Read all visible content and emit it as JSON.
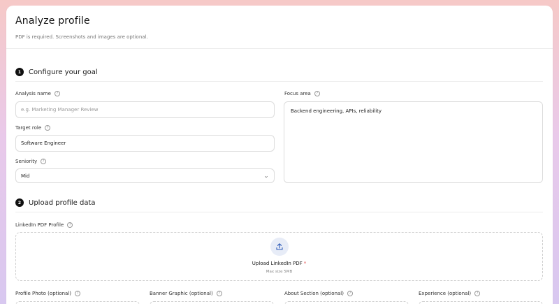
{
  "header": {
    "title": "Analyze profile",
    "subtitle": "PDF is required. Screenshots and images are optional."
  },
  "goal_section": {
    "step": "1",
    "title": "Configure your goal",
    "analysis_name": {
      "label": "Analysis name",
      "value": "",
      "placeholder": "e.g. Marketing Manager Review"
    },
    "target_role": {
      "label": "Target role",
      "value": "Software Engineer"
    },
    "seniority": {
      "label": "Seniority",
      "value": "Mid"
    },
    "focus_area": {
      "label": "Focus area",
      "value": "Backend engineering, APIs, reliability"
    }
  },
  "upload_section": {
    "step": "2",
    "title": "Upload profile data",
    "linkedin": {
      "label": "LinkedIn PDF Profile",
      "upload_label": "Upload LinkedIn PDF",
      "required_mark": "*",
      "max_size": "Max size 5MB"
    },
    "optional_fields": [
      {
        "label": "Profile Photo (optional)"
      },
      {
        "label": "Banner Graphic (optional)"
      },
      {
        "label": "About Section (optional)"
      },
      {
        "label": "Experience (optional)"
      }
    ]
  },
  "icons": {
    "help": "question-circle-icon",
    "chevron": "chevron-down-icon",
    "upload": "upload-icon"
  },
  "colors": {
    "required": "#e04848",
    "upload_bg": "#e7ecf7",
    "upload_icon": "#2d5ab8"
  }
}
